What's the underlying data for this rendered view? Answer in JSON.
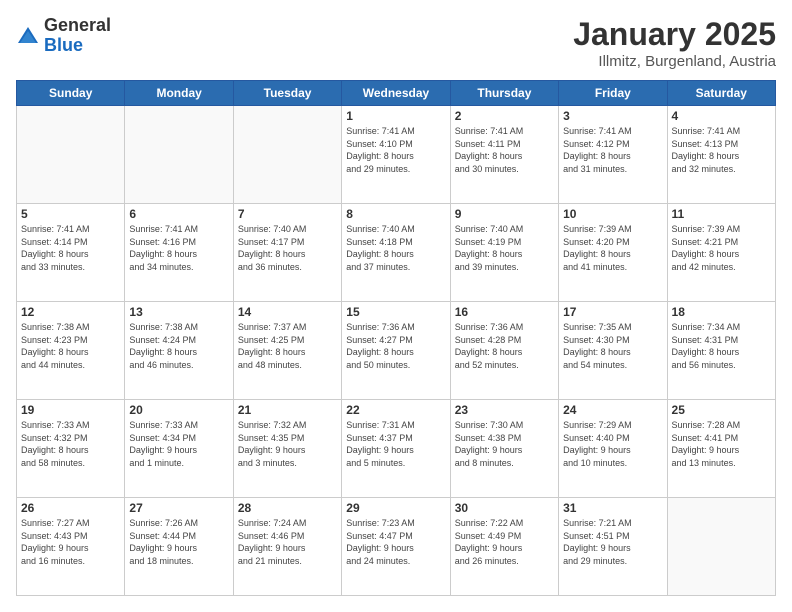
{
  "logo": {
    "general": "General",
    "blue": "Blue"
  },
  "header": {
    "title": "January 2025",
    "subtitle": "Illmitz, Burgenland, Austria"
  },
  "weekdays": [
    "Sunday",
    "Monday",
    "Tuesday",
    "Wednesday",
    "Thursday",
    "Friday",
    "Saturday"
  ],
  "weeks": [
    [
      {
        "day": "",
        "info": ""
      },
      {
        "day": "",
        "info": ""
      },
      {
        "day": "",
        "info": ""
      },
      {
        "day": "1",
        "info": "Sunrise: 7:41 AM\nSunset: 4:10 PM\nDaylight: 8 hours\nand 29 minutes."
      },
      {
        "day": "2",
        "info": "Sunrise: 7:41 AM\nSunset: 4:11 PM\nDaylight: 8 hours\nand 30 minutes."
      },
      {
        "day": "3",
        "info": "Sunrise: 7:41 AM\nSunset: 4:12 PM\nDaylight: 8 hours\nand 31 minutes."
      },
      {
        "day": "4",
        "info": "Sunrise: 7:41 AM\nSunset: 4:13 PM\nDaylight: 8 hours\nand 32 minutes."
      }
    ],
    [
      {
        "day": "5",
        "info": "Sunrise: 7:41 AM\nSunset: 4:14 PM\nDaylight: 8 hours\nand 33 minutes."
      },
      {
        "day": "6",
        "info": "Sunrise: 7:41 AM\nSunset: 4:16 PM\nDaylight: 8 hours\nand 34 minutes."
      },
      {
        "day": "7",
        "info": "Sunrise: 7:40 AM\nSunset: 4:17 PM\nDaylight: 8 hours\nand 36 minutes."
      },
      {
        "day": "8",
        "info": "Sunrise: 7:40 AM\nSunset: 4:18 PM\nDaylight: 8 hours\nand 37 minutes."
      },
      {
        "day": "9",
        "info": "Sunrise: 7:40 AM\nSunset: 4:19 PM\nDaylight: 8 hours\nand 39 minutes."
      },
      {
        "day": "10",
        "info": "Sunrise: 7:39 AM\nSunset: 4:20 PM\nDaylight: 8 hours\nand 41 minutes."
      },
      {
        "day": "11",
        "info": "Sunrise: 7:39 AM\nSunset: 4:21 PM\nDaylight: 8 hours\nand 42 minutes."
      }
    ],
    [
      {
        "day": "12",
        "info": "Sunrise: 7:38 AM\nSunset: 4:23 PM\nDaylight: 8 hours\nand 44 minutes."
      },
      {
        "day": "13",
        "info": "Sunrise: 7:38 AM\nSunset: 4:24 PM\nDaylight: 8 hours\nand 46 minutes."
      },
      {
        "day": "14",
        "info": "Sunrise: 7:37 AM\nSunset: 4:25 PM\nDaylight: 8 hours\nand 48 minutes."
      },
      {
        "day": "15",
        "info": "Sunrise: 7:36 AM\nSunset: 4:27 PM\nDaylight: 8 hours\nand 50 minutes."
      },
      {
        "day": "16",
        "info": "Sunrise: 7:36 AM\nSunset: 4:28 PM\nDaylight: 8 hours\nand 52 minutes."
      },
      {
        "day": "17",
        "info": "Sunrise: 7:35 AM\nSunset: 4:30 PM\nDaylight: 8 hours\nand 54 minutes."
      },
      {
        "day": "18",
        "info": "Sunrise: 7:34 AM\nSunset: 4:31 PM\nDaylight: 8 hours\nand 56 minutes."
      }
    ],
    [
      {
        "day": "19",
        "info": "Sunrise: 7:33 AM\nSunset: 4:32 PM\nDaylight: 8 hours\nand 58 minutes."
      },
      {
        "day": "20",
        "info": "Sunrise: 7:33 AM\nSunset: 4:34 PM\nDaylight: 9 hours\nand 1 minute."
      },
      {
        "day": "21",
        "info": "Sunrise: 7:32 AM\nSunset: 4:35 PM\nDaylight: 9 hours\nand 3 minutes."
      },
      {
        "day": "22",
        "info": "Sunrise: 7:31 AM\nSunset: 4:37 PM\nDaylight: 9 hours\nand 5 minutes."
      },
      {
        "day": "23",
        "info": "Sunrise: 7:30 AM\nSunset: 4:38 PM\nDaylight: 9 hours\nand 8 minutes."
      },
      {
        "day": "24",
        "info": "Sunrise: 7:29 AM\nSunset: 4:40 PM\nDaylight: 9 hours\nand 10 minutes."
      },
      {
        "day": "25",
        "info": "Sunrise: 7:28 AM\nSunset: 4:41 PM\nDaylight: 9 hours\nand 13 minutes."
      }
    ],
    [
      {
        "day": "26",
        "info": "Sunrise: 7:27 AM\nSunset: 4:43 PM\nDaylight: 9 hours\nand 16 minutes."
      },
      {
        "day": "27",
        "info": "Sunrise: 7:26 AM\nSunset: 4:44 PM\nDaylight: 9 hours\nand 18 minutes."
      },
      {
        "day": "28",
        "info": "Sunrise: 7:24 AM\nSunset: 4:46 PM\nDaylight: 9 hours\nand 21 minutes."
      },
      {
        "day": "29",
        "info": "Sunrise: 7:23 AM\nSunset: 4:47 PM\nDaylight: 9 hours\nand 24 minutes."
      },
      {
        "day": "30",
        "info": "Sunrise: 7:22 AM\nSunset: 4:49 PM\nDaylight: 9 hours\nand 26 minutes."
      },
      {
        "day": "31",
        "info": "Sunrise: 7:21 AM\nSunset: 4:51 PM\nDaylight: 9 hours\nand 29 minutes."
      },
      {
        "day": "",
        "info": ""
      }
    ]
  ]
}
